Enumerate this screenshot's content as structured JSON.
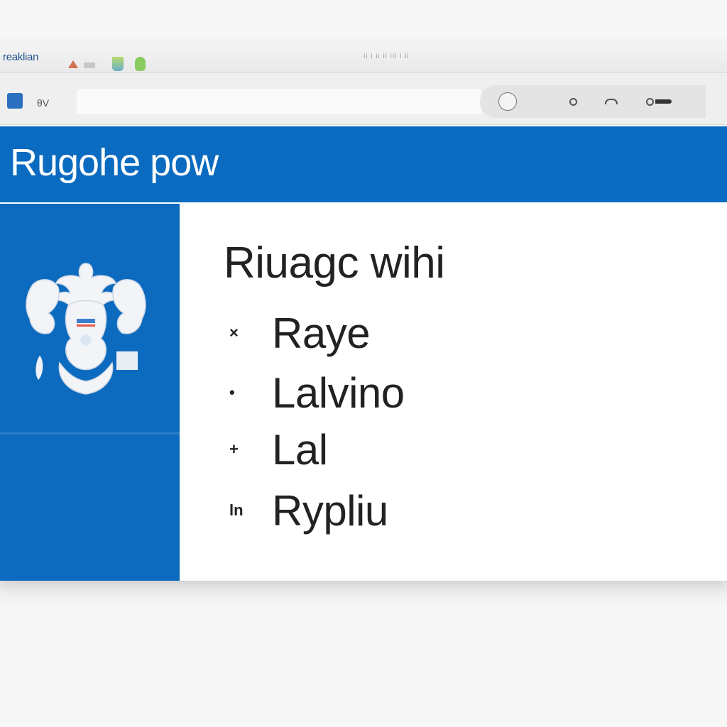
{
  "titlebar": {
    "tab_label": "reaklian",
    "center_text": "ii i ii ii iii i ii"
  },
  "toolbar": {
    "app_icon_letter": "",
    "label": "θV",
    "address_value": "",
    "icons": [
      "avatar-icon",
      "settings-dot-icon",
      "cloud-icon",
      "key-icon"
    ]
  },
  "header": {
    "title": "Rugohe pow"
  },
  "sidebar": {
    "emblem_icon": "coat-of-arms-icon"
  },
  "main": {
    "heading": "Riuagc wihi",
    "items": [
      {
        "mark": "×",
        "label": "Raye"
      },
      {
        "mark": "•",
        "label": "Lalvino"
      },
      {
        "mark": "+",
        "label": "Lal"
      },
      {
        "mark": "ln",
        "label": "Rypliu"
      }
    ]
  },
  "colors": {
    "brand_blue": "#0a6bc0",
    "sidebar_blue": "#0d6bbf",
    "text_dark": "#222222"
  }
}
